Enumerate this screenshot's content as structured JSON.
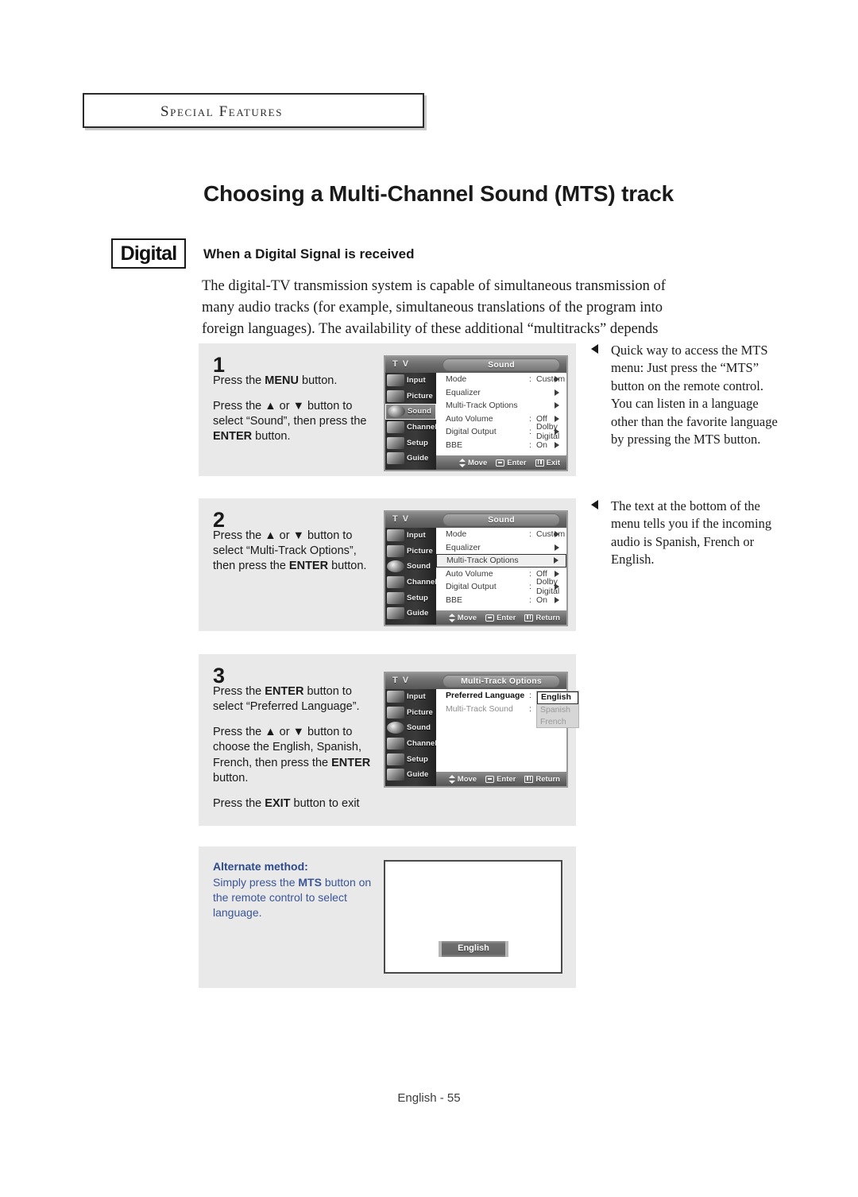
{
  "chapter": {
    "label": "Special Features"
  },
  "page_title": "Choosing a Multi-Channel Sound (MTS) track",
  "badge": {
    "label": "Digital"
  },
  "section": {
    "heading": "When a Digital Signal is received",
    "paragraph": "The digital-TV transmission system is capable of simultaneous transmission of many audio tracks (for example, simultaneous translations of the program into foreign languages). The availability of these additional “multitracks” depends upon the program."
  },
  "steps": [
    {
      "number": "1",
      "lines": [
        "Press the <b>MENU</b> button.",
        "Press the ▲ or ▼ button to select “Sound”, then press the <b>ENTER</b> button."
      ],
      "osd": {
        "brand": "T V",
        "title": "Sound",
        "sidebar": [
          "Input",
          "Picture",
          "Sound",
          "Channel",
          "Setup",
          "Guide"
        ],
        "active_sidebar": "Sound",
        "rows": [
          {
            "key": "Mode",
            "sep": ":",
            "value": "Custom"
          },
          {
            "key": "Equalizer",
            "sep": "",
            "value": ""
          },
          {
            "key": "Multi-Track Options",
            "sep": "",
            "value": ""
          },
          {
            "key": "Auto Volume",
            "sep": ":",
            "value": "Off"
          },
          {
            "key": "Digital Output",
            "sep": ":",
            "value": "Dolby Digital"
          },
          {
            "key": "BBE",
            "sep": ":",
            "value": "On"
          }
        ],
        "highlight_row": -1,
        "footer": [
          "Move",
          "Enter",
          "Exit"
        ]
      }
    },
    {
      "number": "2",
      "lines": [
        "Press the ▲ or ▼ button to select “Multi-Track Options”, then press the <b>ENTER</b> button."
      ],
      "osd": {
        "brand": "T V",
        "title": "Sound",
        "sidebar": [
          "Input",
          "Picture",
          "Sound",
          "Channel",
          "Setup",
          "Guide"
        ],
        "active_sidebar": "",
        "rows": [
          {
            "key": "Mode",
            "sep": ":",
            "value": "Custom"
          },
          {
            "key": "Equalizer",
            "sep": "",
            "value": ""
          },
          {
            "key": "Multi-Track Options",
            "sep": "",
            "value": ""
          },
          {
            "key": "Auto Volume",
            "sep": ":",
            "value": "Off"
          },
          {
            "key": "Digital Output",
            "sep": ":",
            "value": "Dolby Digital"
          },
          {
            "key": "BBE",
            "sep": ":",
            "value": "On"
          }
        ],
        "highlight_row": 2,
        "footer": [
          "Move",
          "Enter",
          "Return"
        ]
      }
    },
    {
      "number": "3",
      "lines": [
        "Press the <b>ENTER</b> button to select “Preferred Language”.",
        "Press the ▲ or ▼ button to choose the English, Spanish, French, then press the <b>ENTER</b> button.",
        "Press the <b>EXIT</b> button to exit"
      ],
      "osd": {
        "brand": "T V",
        "title": "Multi-Track Options",
        "sidebar": [
          "Input",
          "Picture",
          "Sound",
          "Channel",
          "Setup",
          "Guide"
        ],
        "active_sidebar": "",
        "rows": [
          {
            "key": "Preferred Language",
            "sep": ":",
            "value": ""
          },
          {
            "key": "Multi-Track Sound",
            "sep": ":",
            "value": ""
          }
        ],
        "highlight_row": -1,
        "language_options": [
          "English",
          "Spanish",
          "French"
        ],
        "language_selected": "English",
        "footer": [
          "Move",
          "Enter",
          "Return"
        ]
      }
    }
  ],
  "alternate": {
    "heading": "Alternate method:",
    "text": "Simply press the <b>MTS</b> button on the remote control to select language.",
    "screen_button": "English"
  },
  "notes": [
    "Quick way to access the MTS menu: Just press the “MTS” button on the remote control. You can listen in a language other than the favorite language by pressing the MTS button.",
    "The text at the bottom of the menu tells you if the incoming audio is Spanish, French or English."
  ],
  "footer": "English - 55",
  "colors": {
    "panel_bg": "#e9e9e9",
    "alt_blue": "#3a5596",
    "osd_dark": "#2c2c2c"
  }
}
